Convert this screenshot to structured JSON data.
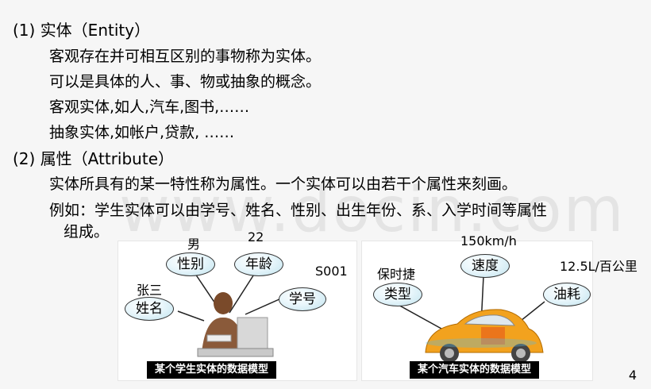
{
  "lines": {
    "l1": "(1) 实体（Entity）",
    "l2": "客观存在并可相互区别的事物称为实体。",
    "l3": "可以是具体的人、事、物或抽象的概念。",
    "l4": "客观实体,如人,汽车,图书,……",
    "l5": "抽象实体,如帐户,贷款, ……",
    "l6": "(2) 属性（Attribute）",
    "l7": "实体所具有的某一特性称为属性。一个实体可以由若干个属性来刻画。",
    "l8": "例如：学生实体可以由学号、姓名、性别、出生年份、系、入学时间等属性",
    "l9": "组成。"
  },
  "watermark": "www.docin.com",
  "student": {
    "values": {
      "gender": "男",
      "age": "22",
      "name": "张三",
      "id": "S001"
    },
    "attrs": {
      "gender": "性别",
      "age": "年龄",
      "name": "姓名",
      "id": "学号"
    },
    "caption": "某个学生实体的数据模型"
  },
  "car": {
    "values": {
      "speed": "150km/h",
      "type": "保时捷",
      "fuel": "12.5L/百公里"
    },
    "attrs": {
      "type": "类型",
      "speed": "速度",
      "fuel": "油耗"
    },
    "caption": "某个汽车实体的数据模型"
  },
  "page_number": "4"
}
